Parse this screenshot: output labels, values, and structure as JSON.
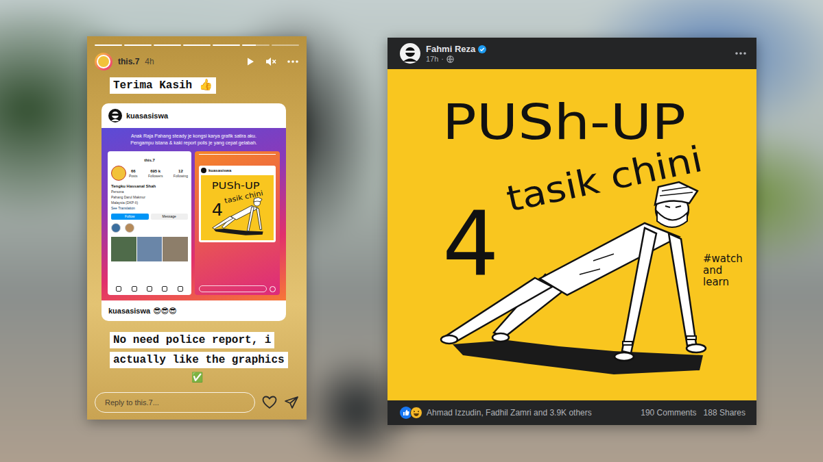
{
  "story": {
    "progress": [
      {
        "level": 1
      },
      {
        "level": 1
      },
      {
        "level": 1
      },
      {
        "level": 1
      },
      {
        "level": 1
      },
      {
        "level": 0.5
      },
      {
        "level": 0
      }
    ],
    "user": "this.7",
    "time": "4h",
    "sticker": "Terima Kasih 👍",
    "shared_post": {
      "user": "kuasasiswa",
      "banner": [
        "Anak Raja Pahang steady je kongsi karya grafik satira aku.",
        "Pengampu istana & kaki report polis je yang cepat gelabah."
      ],
      "profile_shot": {
        "user": "this.7",
        "stats": [
          {
            "value": "66",
            "label": "Posts"
          },
          {
            "value": "695 k",
            "label": "Followers"
          },
          {
            "value": "12",
            "label": "Following"
          }
        ],
        "name": "Tengku Hassanal Shah",
        "bio": [
          "Persona",
          "Pahang Darul Makmur",
          "Malaysia (DKP-II)"
        ],
        "link": "See Translation",
        "buttons": [
          "Follow",
          "Message"
        ]
      },
      "story_shot": {
        "user": "kuasasiswa"
      },
      "caption_user": "kuasasiswa",
      "caption": "😎😎😎"
    },
    "message_lines": [
      "No need police report, i",
      "actually like the graphics"
    ],
    "message_mark": "✅",
    "reply_placeholder": "Reply to this.7..."
  },
  "post": {
    "author": "Fahmi Reza",
    "verified": true,
    "time": "17h",
    "separator": "·",
    "artwork": {
      "title": "PUSh-UP",
      "number": "4",
      "subtitle": "tasik chini",
      "hashtag": [
        "#watch",
        "and",
        "learn"
      ]
    },
    "reactions": "Ahmad Izzudin, Fadhil Zamri and 3.9K others",
    "comments": "190 Comments",
    "shares": "188 Shares"
  }
}
